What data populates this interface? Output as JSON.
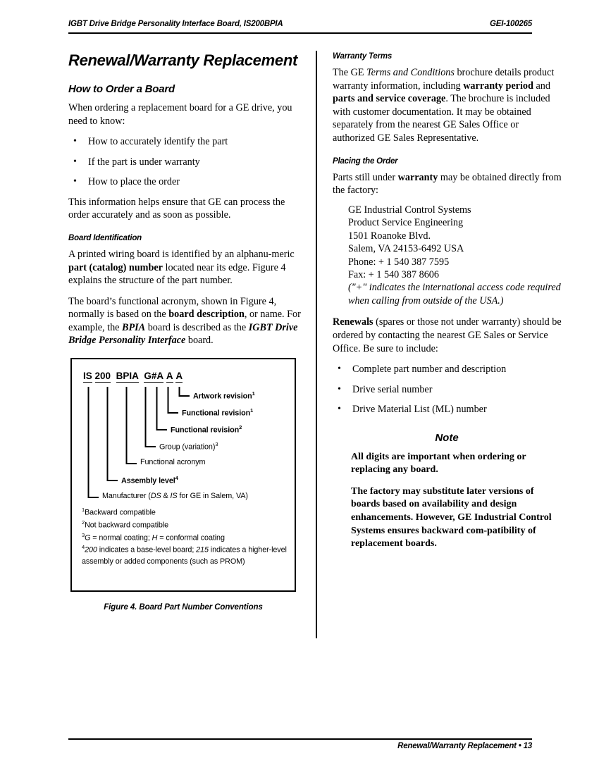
{
  "header": {
    "left": "IGBT Drive Bridge Personality Interface Board, IS200BPIA",
    "right": "GEI-100265"
  },
  "footer": {
    "right": "Renewal/Warranty Replacement  •  13"
  },
  "left_column": {
    "chapter_title": "Renewal/Warranty Replacement",
    "how_to_order": {
      "heading": "How to Order a Board",
      "intro": "When ordering a replacement board for a GE drive, you need  to know:",
      "bullets": [
        "How to accurately identify the part",
        "If the part is under warranty",
        "How to place the order"
      ],
      "closing": "This information helps ensure that GE can process the order accurately and as soon as possible."
    },
    "board_identification": {
      "heading": "Board Identification",
      "para1_a": "A printed wiring board is identified by an alphanu-meric ",
      "para1_b": "part (catalog) number",
      "para1_c": " located near its edge. Figure 4 explains the structure of the part number.",
      "para2_a": "The board’s functional acronym, shown in Figure 4, normally is based on the ",
      "para2_b": "board description",
      "para2_c": ", or name. For example, the ",
      "para2_d": "BPIA",
      "para2_e": " board is described as the ",
      "para2_f": "IGBT Drive Bridge Personality Interface",
      "para2_g": " board."
    }
  },
  "figure": {
    "caption": "Figure 4.  Board Part Number Conventions",
    "part_number_segments": [
      "IS",
      "200",
      "BPIA",
      "G#",
      "A",
      "A",
      "A"
    ],
    "labels": [
      {
        "text": "Artwork revision",
        "sup": "1",
        "bold": true
      },
      {
        "text": "Functional revision",
        "sup": "1",
        "bold": true
      },
      {
        "text": "Functional revision",
        "sup": "2",
        "bold": true
      },
      {
        "text": "Group (variation)",
        "sup": "3",
        "bold": false
      },
      {
        "text": "Functional acronym",
        "sup": "",
        "bold": false
      },
      {
        "text": "Assembly level",
        "sup": "4",
        "bold": true
      },
      {
        "text": "Manufacturer (DS & IS for GE in Salem, VA)",
        "sup": "",
        "bold": false
      }
    ],
    "label_manufacturer": {
      "pre": "Manufacturer (",
      "it1": "DS",
      "mid1": " & ",
      "it2": "IS",
      "post": " for GE in Salem, VA)"
    },
    "footnotes": {
      "fn1_sup": "1",
      "fn1": "Backward compatible",
      "fn2_sup": "2",
      "fn2": "Not backward compatible",
      "fn3_sup": "3",
      "fn3_a": "G",
      "fn3_b": " = normal coating; ",
      "fn3_c": "H",
      "fn3_d": " = conformal coating",
      "fn4_sup": "4",
      "fn4_a": "200",
      "fn4_b": " indicates a base-level board; ",
      "fn4_c": "215",
      "fn4_d": " indicates a higher-level assembly or added components (such as PROM)"
    }
  },
  "right_column": {
    "warranty_terms": {
      "heading": "Warranty Terms",
      "p_a": "The GE ",
      "p_b": "Terms and Conditions",
      "p_c": " brochure details product warranty information, including ",
      "p_d": "warranty period",
      "p_e": " and ",
      "p_f": "parts and service coverage",
      "p_g": ". The brochure is included with customer documentation. It may be obtained separately from the nearest GE Sales Office or authorized GE Sales Representative."
    },
    "placing_the_order": {
      "heading": "Placing the Order",
      "p_a": "Parts still under ",
      "p_b": "warranty",
      "p_c": " may be obtained directly from the factory:",
      "address": [
        "GE Industrial Control Systems",
        "Product Service Engineering",
        "1501 Roanoke Blvd.",
        "Salem, VA 24153-6492  USA",
        "Phone:  + 1 540 387 7595",
        "Fax:  + 1 540 387 8606"
      ],
      "address_note": "(\"+\" indicates the international access code required when calling from outside of the USA.)",
      "renewals_a": "Renewals",
      "renewals_b": " (spares or those not under warranty) should be ordered by contacting the nearest GE Sales or Service Office. Be sure to include:",
      "bullets": [
        "Complete part number and description",
        "Drive serial number",
        "Drive Material List (ML) number"
      ]
    },
    "note": {
      "title": "Note",
      "p1": "All digits are important when ordering or replacing any board.",
      "p2": "The factory may substitute later versions of boards based on availability and design enhancements. However, GE Industrial Control Systems ensures backward com-patibility of replacement boards."
    }
  }
}
